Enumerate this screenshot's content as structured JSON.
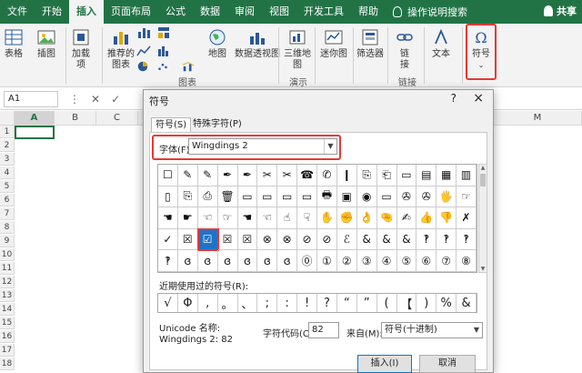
{
  "ribbon_tabs": [
    "文件",
    "开始",
    "插入",
    "页面布局",
    "公式",
    "数据",
    "审阅",
    "视图",
    "开发工具",
    "帮助"
  ],
  "tell_me": "操作说明搜索",
  "share": "共享",
  "ribbon": {
    "table": "表格",
    "illustration": "插图",
    "addin": "加载\n项",
    "rec_chart": "推荐的\n图表",
    "map": "地图",
    "pivot_chart": "数据透视图",
    "map3d": "三维地\n图",
    "sparkline": "迷你图",
    "slicer": "筛选器",
    "link": "链\n接",
    "text": "文本",
    "symbol": "符号",
    "group_chart": "图表",
    "group_demo": "演示",
    "group_link": "链接"
  },
  "formula_bar": {
    "namebox": "A1"
  },
  "grid": {
    "columns": [
      "A",
      "B",
      "C",
      "M"
    ],
    "rows": [
      "1",
      "2",
      "3",
      "4",
      "5",
      "6",
      "7",
      "8",
      "9",
      "10",
      "11",
      "12",
      "13",
      "14",
      "15",
      "16",
      "17",
      "18"
    ]
  },
  "dialog": {
    "title": "符号",
    "help": "?",
    "close": "×",
    "tab_symbols": "符号(S)",
    "tab_special": "特殊字符(P)",
    "font_label": "字体(F):",
    "font_value": "Wingdings 2",
    "symbols": [
      "☐",
      "✎",
      "✎",
      "✒",
      "✒",
      "✂",
      "✂",
      "☎",
      "✆",
      "❙",
      "⎘",
      "⎗",
      "▭",
      "▤",
      "▦",
      "▥",
      "▯",
      "⎘",
      "⎙",
      "🗑",
      "▭",
      "▭",
      "▭",
      "▭",
      "🖶",
      "▣",
      "◉",
      "▭",
      "✇",
      "✇",
      "🖐",
      "☞",
      "☚",
      "☛",
      "☜",
      "☞",
      "☚",
      "☜",
      "☝",
      "☟",
      "✋",
      "✊",
      "👌",
      "🤏",
      "✍",
      "👍",
      "👎",
      "✗",
      "✓",
      "☒",
      "☑",
      "☒",
      "☒",
      "⊗",
      "⊗",
      "⊘",
      "⊘",
      "ℰ",
      "&",
      "&",
      "&",
      "‽",
      "‽",
      "‽",
      "‽",
      "ɞ",
      "ɞ",
      "ɞ",
      "ɞ",
      "ɞ",
      "ɞ",
      "⓪",
      "①",
      "②",
      "③",
      "④",
      "⑤",
      "⑥",
      "⑦",
      "⑧"
    ],
    "selected_index": 50,
    "recent_label": "近期使用过的符号(R):",
    "recent": [
      "√",
      "Φ",
      ",",
      "。",
      "、",
      ";",
      ":",
      "!",
      "?",
      "“",
      "”",
      "(",
      "【",
      ")",
      "%",
      "&"
    ],
    "unicode_label": "Unicode 名称:",
    "unicode_value": "Wingdings 2: 82",
    "code_label": "字符代码(C):",
    "code_value": "82",
    "from_label": "来自(M):",
    "from_value": "符号(十进制)",
    "insert": "插入(I)",
    "cancel": "取消"
  }
}
